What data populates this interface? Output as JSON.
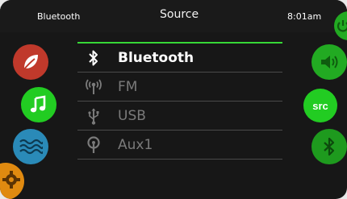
{
  "status_bar": {
    "left_text": "Bluetooth",
    "title": "Source",
    "time": "8:01am"
  },
  "left_buttons": [
    {
      "icon": "leaf-icon",
      "color": "#c0392b"
    },
    {
      "icon": "music-note-icon",
      "color": "#22cc22"
    },
    {
      "icon": "waves-icon",
      "color": "#2a8ab8"
    },
    {
      "icon": "gear-icon",
      "color": "#e08a10"
    }
  ],
  "right_buttons": [
    {
      "icon": "power-icon",
      "color": "#22aa22"
    },
    {
      "icon": "speaker-icon",
      "color": "#22aa22"
    },
    {
      "label": "src",
      "color": "#22cc22"
    },
    {
      "icon": "bluetooth-icon",
      "color": "#1e9a1e"
    }
  ],
  "source_list": [
    {
      "label": "Bluetooth",
      "icon": "bluetooth-icon",
      "selected": true
    },
    {
      "label": "FM",
      "icon": "radio-antenna-icon",
      "selected": false
    },
    {
      "label": "USB",
      "icon": "usb-icon",
      "selected": false
    },
    {
      "label": "Aux1",
      "icon": "aux-plug-icon",
      "selected": false
    }
  ],
  "accent_color": "#37d837"
}
